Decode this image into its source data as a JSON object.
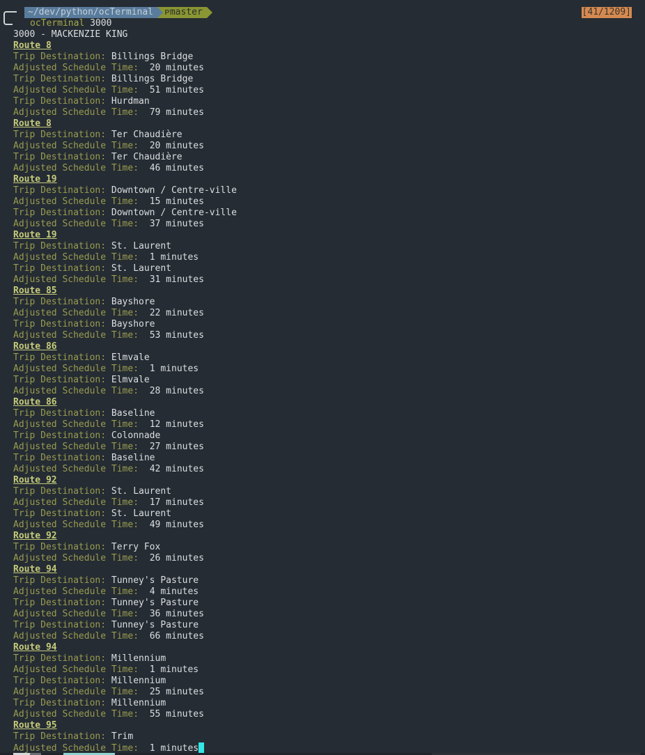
{
  "prompt": {
    "directory": "~/dev/python/ocTerminal",
    "branch_icon": "git-branch-icon",
    "branch_glyph": "ᴾ",
    "branch": "master",
    "command": "ocTerminal",
    "argument": "3000"
  },
  "counter": "[41/1209]",
  "colors": {
    "background": "#252c33",
    "dir_segment": "#5a7c9c",
    "git_segment": "#8a9634",
    "route_header": "#c6cb7b",
    "label": "#9a9c50",
    "value": "#dcdfe2",
    "counter_bg": "#d58a52",
    "cursor": "#34e6e6"
  },
  "stop_title": "3000 - MACKENZIE KING",
  "labels": {
    "destination": "Trip Destination:",
    "time_adjusted": "Adjusted Schedule",
    "time_suffix": "Time:"
  },
  "output": [
    {
      "type": "route",
      "text": "Route 8"
    },
    {
      "type": "dest",
      "value": "Billings Bridge"
    },
    {
      "type": "time",
      "value": "20 minutes"
    },
    {
      "type": "dest",
      "value": "Billings Bridge"
    },
    {
      "type": "time",
      "value": "51 minutes"
    },
    {
      "type": "dest",
      "value": "Hurdman"
    },
    {
      "type": "time",
      "value": "79 minutes"
    },
    {
      "type": "route",
      "text": "Route 8"
    },
    {
      "type": "dest",
      "value": "Ter Chaudière"
    },
    {
      "type": "time",
      "value": "20 minutes"
    },
    {
      "type": "dest",
      "value": "Ter Chaudière"
    },
    {
      "type": "time",
      "value": "46 minutes"
    },
    {
      "type": "route",
      "text": "Route 19"
    },
    {
      "type": "dest",
      "value": "Downtown / Centre-ville"
    },
    {
      "type": "time",
      "value": "15 minutes"
    },
    {
      "type": "dest",
      "value": "Downtown / Centre-ville"
    },
    {
      "type": "time",
      "value": "37 minutes"
    },
    {
      "type": "route",
      "text": "Route 19"
    },
    {
      "type": "dest",
      "value": "St. Laurent"
    },
    {
      "type": "time",
      "value": "1 minutes"
    },
    {
      "type": "dest",
      "value": "St. Laurent"
    },
    {
      "type": "time",
      "value": "31 minutes"
    },
    {
      "type": "route",
      "text": "Route 85"
    },
    {
      "type": "dest",
      "value": "Bayshore"
    },
    {
      "type": "time",
      "value": "22 minutes"
    },
    {
      "type": "dest",
      "value": "Bayshore"
    },
    {
      "type": "time",
      "value": "53 minutes"
    },
    {
      "type": "route",
      "text": "Route 86"
    },
    {
      "type": "dest",
      "value": "Elmvale"
    },
    {
      "type": "time",
      "value": "1 minutes"
    },
    {
      "type": "dest",
      "value": "Elmvale"
    },
    {
      "type": "time",
      "value": "28 minutes"
    },
    {
      "type": "route",
      "text": "Route 86"
    },
    {
      "type": "dest",
      "value": "Baseline"
    },
    {
      "type": "time",
      "value": "12 minutes"
    },
    {
      "type": "dest",
      "value": "Colonnade"
    },
    {
      "type": "time",
      "value": "27 minutes"
    },
    {
      "type": "dest",
      "value": "Baseline"
    },
    {
      "type": "time",
      "value": "42 minutes"
    },
    {
      "type": "route",
      "text": "Route 92"
    },
    {
      "type": "dest",
      "value": "St. Laurent"
    },
    {
      "type": "time",
      "value": "17 minutes"
    },
    {
      "type": "dest",
      "value": "St. Laurent"
    },
    {
      "type": "time",
      "value": "49 minutes"
    },
    {
      "type": "route",
      "text": "Route 92"
    },
    {
      "type": "dest",
      "value": "Terry Fox"
    },
    {
      "type": "time",
      "value": "26 minutes"
    },
    {
      "type": "route",
      "text": "Route 94"
    },
    {
      "type": "dest",
      "value": "Tunney's Pasture"
    },
    {
      "type": "time",
      "value": "4 minutes"
    },
    {
      "type": "dest",
      "value": "Tunney's Pasture"
    },
    {
      "type": "time",
      "value": "36 minutes"
    },
    {
      "type": "dest",
      "value": "Tunney's Pasture"
    },
    {
      "type": "time",
      "value": "66 minutes"
    },
    {
      "type": "route",
      "text": "Route 94"
    },
    {
      "type": "dest",
      "value": "Millennium"
    },
    {
      "type": "time",
      "value": "1 minutes"
    },
    {
      "type": "dest",
      "value": "Millennium"
    },
    {
      "type": "time",
      "value": "25 minutes"
    },
    {
      "type": "dest",
      "value": "Millennium"
    },
    {
      "type": "time",
      "value": "55 minutes"
    },
    {
      "type": "route",
      "text": "Route 95"
    },
    {
      "type": "dest",
      "value": "Trim"
    },
    {
      "type": "time",
      "value": "1 minutes"
    }
  ]
}
